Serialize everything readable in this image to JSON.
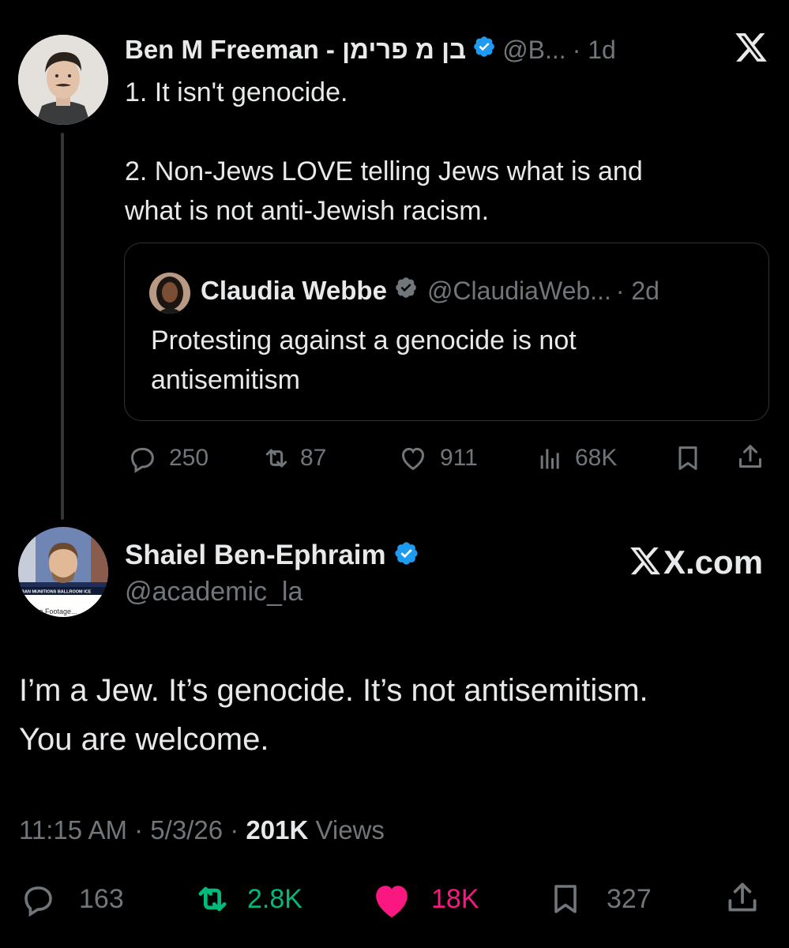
{
  "parent_tweet": {
    "author_name": "Ben M Freeman - בן מ פרימן",
    "handle": "@B...",
    "time": "· 1d",
    "text_line1": "1. It isn't genocide.",
    "text_line2": "2. Non-Jews LOVE telling Jews what is and",
    "text_line3": "what is not anti-Jewish racism.",
    "quote": {
      "author_name": "Claudia Webbe",
      "handle": "@ClaudiaWeb...",
      "time": "· 2d",
      "text_line1": "Protesting against a genocide is not",
      "text_line2": "antisemitism"
    },
    "stats": {
      "replies": "250",
      "reposts": "87",
      "likes": "911",
      "views": "68K"
    }
  },
  "main_tweet": {
    "author_name": "Shaiel Ben-Ephraim",
    "handle": "@academic_la",
    "site_label": "X.com",
    "text_line1": "I’m a Jew. It’s genocide. It’s not antisemitism.",
    "text_line2": "You are welcome.",
    "timestamp": "11:15 AM · 5/3/26 ·",
    "views_count": "201K",
    "views_label": "Views",
    "stats": {
      "replies": "163",
      "reposts": "2.8K",
      "likes": "18K",
      "bookmarks": "327"
    }
  },
  "avatar_caption": "...ne Footage...",
  "colors": {
    "background": "#000000",
    "text": "#e7e9ea",
    "muted": "#71767b",
    "verified": "#1d9bf0",
    "repost_active": "#00ba7c",
    "like_active": "#f91880"
  },
  "icons": [
    "x-logo-icon",
    "verified-badge-icon",
    "reply-icon",
    "repost-icon",
    "like-icon",
    "views-icon",
    "bookmark-icon",
    "share-icon"
  ]
}
